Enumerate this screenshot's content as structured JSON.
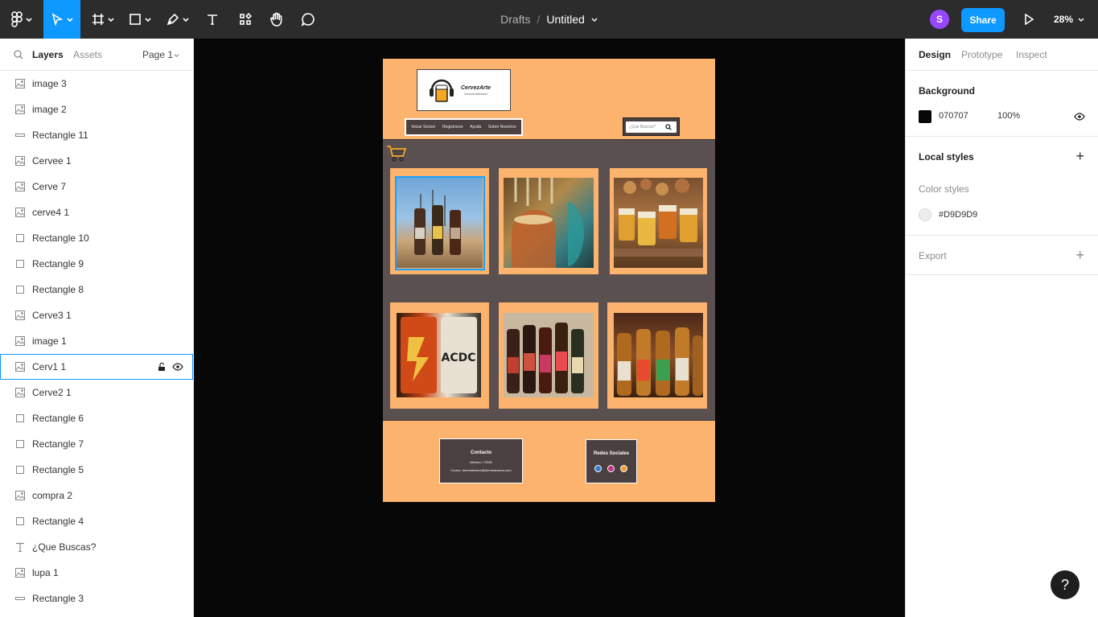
{
  "toolbar": {
    "breadcrumb_drafts": "Drafts",
    "breadcrumb_sep": "/",
    "file_name": "Untitled",
    "avatar_initial": "S",
    "share_label": "Share",
    "zoom_level": "28%",
    "tools": [
      "main-menu",
      "move-tool",
      "frame-tool",
      "shape-tool",
      "pen-tool",
      "text-tool",
      "resources-tool",
      "hand-tool",
      "comment-tool"
    ]
  },
  "left_panel": {
    "tab_layers": "Layers",
    "tab_assets": "Assets",
    "page_selector": "Page 1",
    "layers": [
      {
        "name": "image 3",
        "icon": "image"
      },
      {
        "name": "image 2",
        "icon": "image"
      },
      {
        "name": "Rectangle 11",
        "icon": "line-rect"
      },
      {
        "name": "Cervee 1",
        "icon": "image"
      },
      {
        "name": "Cerve 7",
        "icon": "image"
      },
      {
        "name": "cerve4 1",
        "icon": "image"
      },
      {
        "name": "Rectangle 10",
        "icon": "rect"
      },
      {
        "name": "Rectangle 9",
        "icon": "rect"
      },
      {
        "name": "Rectangle 8",
        "icon": "rect"
      },
      {
        "name": "Cerve3 1",
        "icon": "image"
      },
      {
        "name": "image 1",
        "icon": "image"
      },
      {
        "name": "Cerv1 1",
        "icon": "image",
        "selected": true
      },
      {
        "name": "Cerve2 1",
        "icon": "image"
      },
      {
        "name": "Rectangle 6",
        "icon": "rect"
      },
      {
        "name": "Rectangle 7",
        "icon": "rect"
      },
      {
        "name": "Rectangle 5",
        "icon": "rect"
      },
      {
        "name": "compra 2",
        "icon": "image"
      },
      {
        "name": "Rectangle 4",
        "icon": "rect"
      },
      {
        "name": "¿Que Buscas?",
        "icon": "text"
      },
      {
        "name": "lupa 1",
        "icon": "image"
      },
      {
        "name": "Rectangle 3",
        "icon": "line-rect"
      }
    ]
  },
  "right_panel": {
    "tab_design": "Design",
    "tab_prototype": "Prototype",
    "tab_inspect": "Inspect",
    "background_label": "Background",
    "background_hex": "070707",
    "background_opacity": "100%",
    "local_styles_label": "Local styles",
    "color_styles_label": "Color styles",
    "color_style_value": "#D9D9D9",
    "export_label": "Export",
    "help_label": "?"
  },
  "design": {
    "logo_title": "CervezArte",
    "logo_subtitle": "Cerveza Artesanal",
    "nav_items": [
      "Iniciar Sesion",
      "Registrarse",
      "Ayuda",
      "Sobre Nosotros"
    ],
    "search_placeholder": "¿Que Buscas?",
    "footer_contact_title": "Contacto",
    "footer_contact_phone": "telefono: 72345",
    "footer_contact_email": "Correo: demostracion@demostracion.com",
    "footer_social_title": "Redes Sociales"
  },
  "colors": {
    "accent": "#0d99ff",
    "frame_orange": "#fbb36e",
    "frame_dark": "#5a5050",
    "canvas_bg": "#070707",
    "swatch": "#d9d9d9"
  }
}
